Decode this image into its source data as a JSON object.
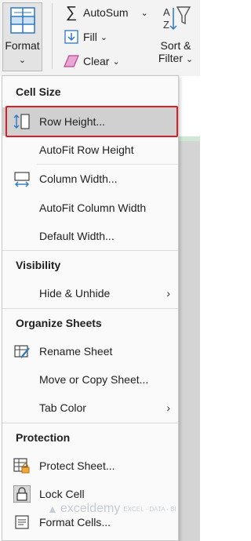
{
  "ribbon": {
    "format_label": "Format",
    "format_chevron": "⌄",
    "autosum_label": "AutoSum",
    "autosum_chevron": "⌄",
    "fill_label": "Fill",
    "fill_chevron": "⌄",
    "clear_label": "Clear",
    "clear_chevron": "⌄",
    "sort_label_1": "Sort &",
    "sort_label_2": "Filter",
    "sort_chevron": "⌄"
  },
  "menu": {
    "cell_size_header": "Cell Size",
    "items_cell_size": [
      {
        "label": "Row Height...",
        "icon": "row-height-icon"
      },
      {
        "label": "AutoFit Row Height",
        "icon": ""
      },
      {
        "label": "Column Width...",
        "icon": "column-width-icon"
      },
      {
        "label": "AutoFit Column Width",
        "icon": ""
      },
      {
        "label": "Default Width...",
        "icon": ""
      }
    ],
    "visibility_header": "Visibility",
    "items_visibility": [
      {
        "label": "Hide & Unhide",
        "arrow": "›"
      }
    ],
    "organize_header": "Organize Sheets",
    "items_organize": [
      {
        "label": "Rename Sheet",
        "icon": "rename-sheet-icon"
      },
      {
        "label": "Move or Copy Sheet...",
        "icon": ""
      },
      {
        "label": "Tab Color",
        "arrow": "›"
      }
    ],
    "protection_header": "Protection",
    "items_protection": [
      {
        "label": "Protect Sheet...",
        "icon": "protect-sheet-icon"
      },
      {
        "label": "Lock Cell",
        "icon": "lock-icon"
      },
      {
        "label": "Format Cells...",
        "icon": "format-cells-icon"
      }
    ]
  },
  "watermark": {
    "name": "exceldemy",
    "tagline": "EXCEL · DATA · BI"
  },
  "colors": {
    "highlight_border": "#d61f26",
    "menu_bg": "#fafafa",
    "accent_blue": "#2b78c5",
    "sheet_gray": "#d4d4d4"
  }
}
